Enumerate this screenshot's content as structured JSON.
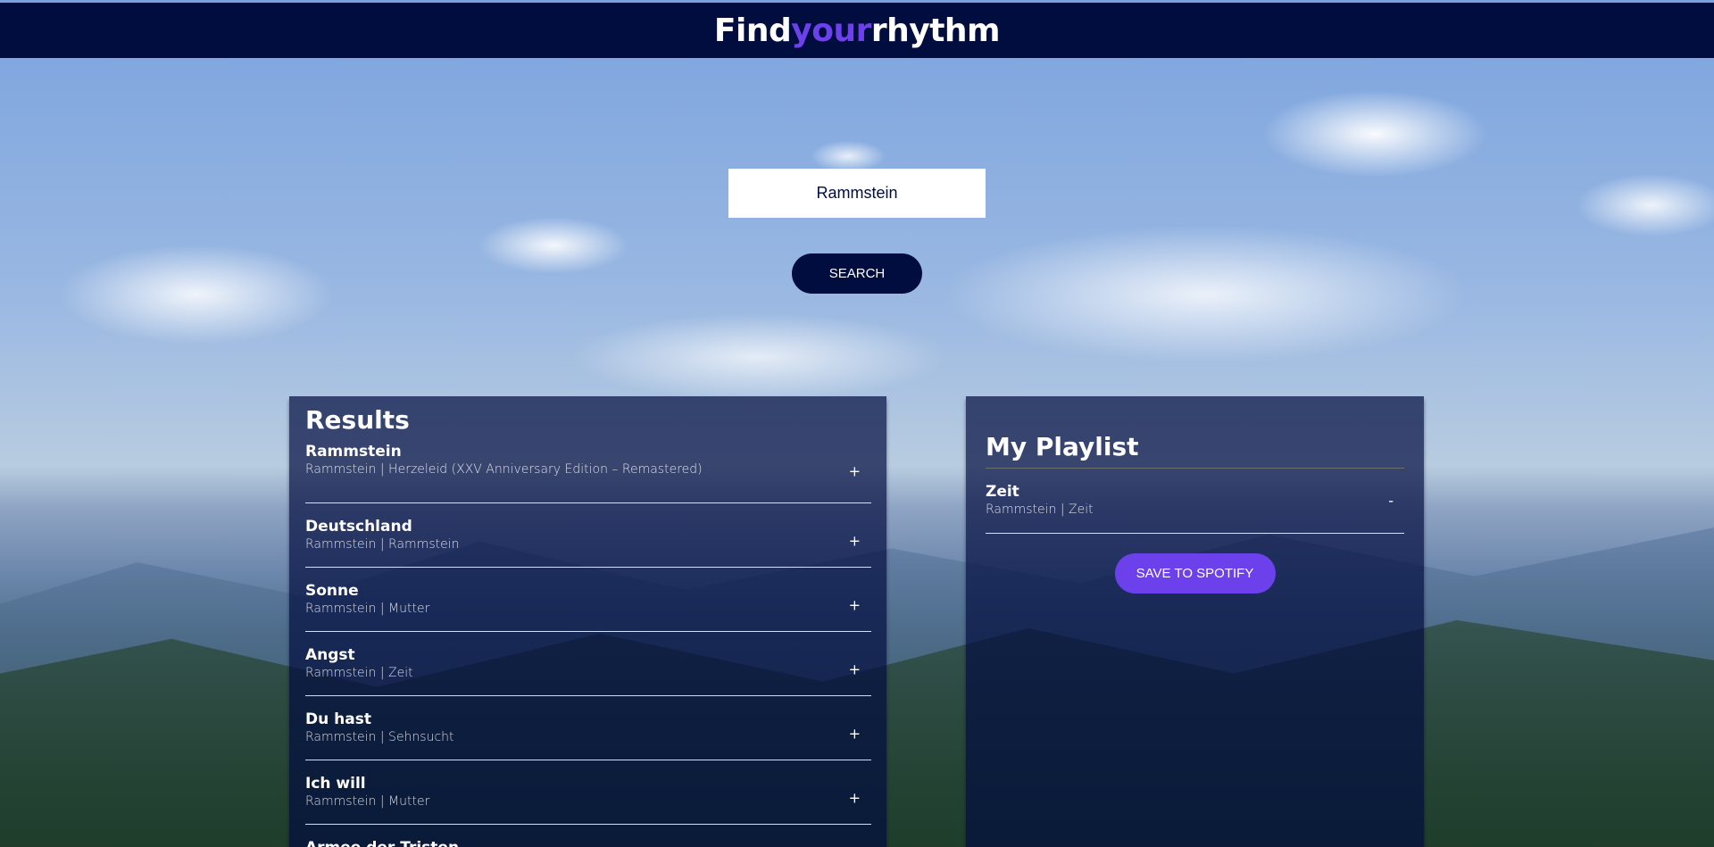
{
  "header": {
    "logo_part1": "Find",
    "logo_part2": "your",
    "logo_part3": "rhythm"
  },
  "search": {
    "value": "Rammstein",
    "button_label": "SEARCH"
  },
  "results": {
    "title": "Results",
    "add_symbol": "+",
    "tracks": [
      {
        "name": "Rammstein",
        "info": "Rammstein | Herzeleid (XXV Anniversary Edition – Remastered)"
      },
      {
        "name": "Deutschland",
        "info": "Rammstein | Rammstein"
      },
      {
        "name": "Sonne",
        "info": "Rammstein | Mutter"
      },
      {
        "name": "Angst",
        "info": "Rammstein | Zeit"
      },
      {
        "name": "Du hast",
        "info": "Rammstein | Sehnsucht"
      },
      {
        "name": "Ich will",
        "info": "Rammstein | Mutter"
      },
      {
        "name": "Armee der Tristen",
        "info": ""
      }
    ]
  },
  "playlist": {
    "title": "My Playlist",
    "remove_symbol": "-",
    "tracks": [
      {
        "name": "Zeit",
        "info": "Rammstein | Zeit"
      }
    ],
    "save_label": "SAVE TO SPOTIFY"
  },
  "colors": {
    "header_bg": "#010c3f",
    "accent": "#6c41ec",
    "panel_bg": "rgba(1,12,63,0.7)"
  }
}
